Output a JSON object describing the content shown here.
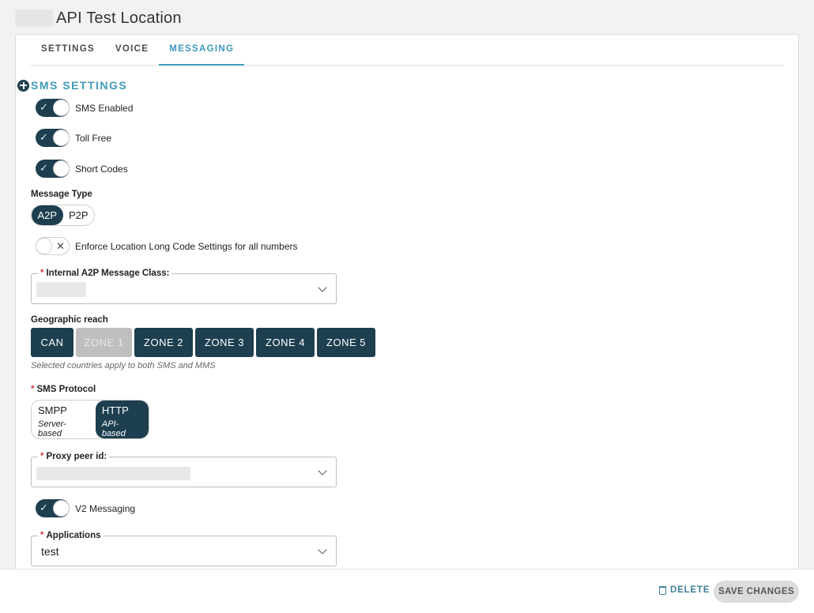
{
  "header": {
    "title": "API Test Location"
  },
  "tabs": [
    {
      "label": "SETTINGS"
    },
    {
      "label": "VOICE"
    },
    {
      "label": "MESSAGING"
    }
  ],
  "sms": {
    "section_title": "SMS SETTINGS",
    "sms_enabled": {
      "label": "SMS Enabled",
      "on": true
    },
    "toll_free": {
      "label": "Toll Free",
      "on": true
    },
    "short_codes": {
      "label": "Short Codes",
      "on": true
    },
    "message_type": {
      "label": "Message Type",
      "options": [
        "A2P",
        "P2P"
      ],
      "selected": "A2P"
    },
    "enforce": {
      "label": "Enforce Location Long Code Settings for all numbers",
      "on": false
    },
    "a2p_class": {
      "label": "Internal A2P Message Class:"
    },
    "geo": {
      "label": "Geographic reach",
      "zones": [
        "CAN",
        "ZONE 1",
        "ZONE 2",
        "ZONE 3",
        "ZONE 4",
        "ZONE 5"
      ],
      "hint": "Selected countries apply to both SMS and MMS"
    },
    "protocol": {
      "label": "SMS Protocol",
      "options": [
        {
          "name": "SMPP",
          "sub": "Server-based"
        },
        {
          "name": "HTTP",
          "sub": "API-based"
        }
      ],
      "selected": "HTTP"
    },
    "proxy": {
      "label": "Proxy peer id:"
    },
    "v2": {
      "label": "V2 Messaging",
      "on": true
    },
    "applications": {
      "label": "Applications",
      "value": "test"
    }
  },
  "footer": {
    "delete_label": "DELETE",
    "save_label": "SAVE CHANGES"
  },
  "colors": {
    "primary": "#1d3f4f",
    "accent": "#3d9ab8",
    "required": "#d63c3c"
  }
}
